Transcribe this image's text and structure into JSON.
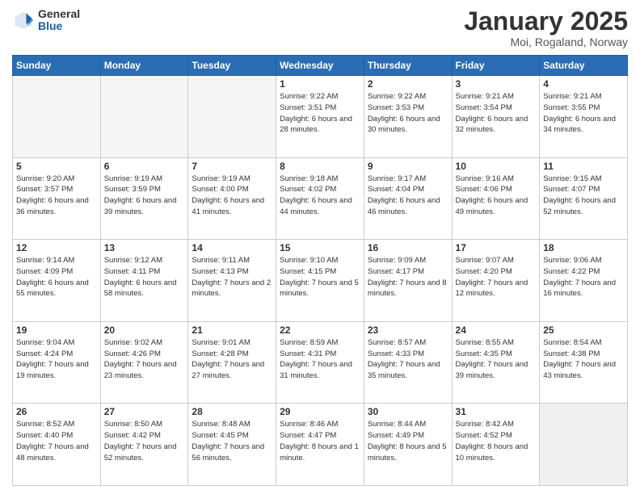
{
  "header": {
    "logo_general": "General",
    "logo_blue": "Blue",
    "month_title": "January 2025",
    "location": "Moi, Rogaland, Norway"
  },
  "weekdays": [
    "Sunday",
    "Monday",
    "Tuesday",
    "Wednesday",
    "Thursday",
    "Friday",
    "Saturday"
  ],
  "weeks": [
    [
      {
        "day": "",
        "empty": true
      },
      {
        "day": "",
        "empty": true
      },
      {
        "day": "",
        "empty": true
      },
      {
        "day": "1",
        "sunrise": "9:22 AM",
        "sunset": "3:51 PM",
        "daylight": "6 hours and 28 minutes."
      },
      {
        "day": "2",
        "sunrise": "9:22 AM",
        "sunset": "3:53 PM",
        "daylight": "6 hours and 30 minutes."
      },
      {
        "day": "3",
        "sunrise": "9:21 AM",
        "sunset": "3:54 PM",
        "daylight": "6 hours and 32 minutes."
      },
      {
        "day": "4",
        "sunrise": "9:21 AM",
        "sunset": "3:55 PM",
        "daylight": "6 hours and 34 minutes."
      }
    ],
    [
      {
        "day": "5",
        "sunrise": "9:20 AM",
        "sunset": "3:57 PM",
        "daylight": "6 hours and 36 minutes."
      },
      {
        "day": "6",
        "sunrise": "9:19 AM",
        "sunset": "3:59 PM",
        "daylight": "6 hours and 39 minutes."
      },
      {
        "day": "7",
        "sunrise": "9:19 AM",
        "sunset": "4:00 PM",
        "daylight": "6 hours and 41 minutes."
      },
      {
        "day": "8",
        "sunrise": "9:18 AM",
        "sunset": "4:02 PM",
        "daylight": "6 hours and 44 minutes."
      },
      {
        "day": "9",
        "sunrise": "9:17 AM",
        "sunset": "4:04 PM",
        "daylight": "6 hours and 46 minutes."
      },
      {
        "day": "10",
        "sunrise": "9:16 AM",
        "sunset": "4:06 PM",
        "daylight": "6 hours and 49 minutes."
      },
      {
        "day": "11",
        "sunrise": "9:15 AM",
        "sunset": "4:07 PM",
        "daylight": "6 hours and 52 minutes."
      }
    ],
    [
      {
        "day": "12",
        "sunrise": "9:14 AM",
        "sunset": "4:09 PM",
        "daylight": "6 hours and 55 minutes."
      },
      {
        "day": "13",
        "sunrise": "9:12 AM",
        "sunset": "4:11 PM",
        "daylight": "6 hours and 58 minutes."
      },
      {
        "day": "14",
        "sunrise": "9:11 AM",
        "sunset": "4:13 PM",
        "daylight": "7 hours and 2 minutes."
      },
      {
        "day": "15",
        "sunrise": "9:10 AM",
        "sunset": "4:15 PM",
        "daylight": "7 hours and 5 minutes."
      },
      {
        "day": "16",
        "sunrise": "9:09 AM",
        "sunset": "4:17 PM",
        "daylight": "7 hours and 8 minutes."
      },
      {
        "day": "17",
        "sunrise": "9:07 AM",
        "sunset": "4:20 PM",
        "daylight": "7 hours and 12 minutes."
      },
      {
        "day": "18",
        "sunrise": "9:06 AM",
        "sunset": "4:22 PM",
        "daylight": "7 hours and 16 minutes."
      }
    ],
    [
      {
        "day": "19",
        "sunrise": "9:04 AM",
        "sunset": "4:24 PM",
        "daylight": "7 hours and 19 minutes."
      },
      {
        "day": "20",
        "sunrise": "9:02 AM",
        "sunset": "4:26 PM",
        "daylight": "7 hours and 23 minutes."
      },
      {
        "day": "21",
        "sunrise": "9:01 AM",
        "sunset": "4:28 PM",
        "daylight": "7 hours and 27 minutes."
      },
      {
        "day": "22",
        "sunrise": "8:59 AM",
        "sunset": "4:31 PM",
        "daylight": "7 hours and 31 minutes."
      },
      {
        "day": "23",
        "sunrise": "8:57 AM",
        "sunset": "4:33 PM",
        "daylight": "7 hours and 35 minutes."
      },
      {
        "day": "24",
        "sunrise": "8:55 AM",
        "sunset": "4:35 PM",
        "daylight": "7 hours and 39 minutes."
      },
      {
        "day": "25",
        "sunrise": "8:54 AM",
        "sunset": "4:38 PM",
        "daylight": "7 hours and 43 minutes."
      }
    ],
    [
      {
        "day": "26",
        "sunrise": "8:52 AM",
        "sunset": "4:40 PM",
        "daylight": "7 hours and 48 minutes."
      },
      {
        "day": "27",
        "sunrise": "8:50 AM",
        "sunset": "4:42 PM",
        "daylight": "7 hours and 52 minutes."
      },
      {
        "day": "28",
        "sunrise": "8:48 AM",
        "sunset": "4:45 PM",
        "daylight": "7 hours and 56 minutes."
      },
      {
        "day": "29",
        "sunrise": "8:46 AM",
        "sunset": "4:47 PM",
        "daylight": "8 hours and 1 minute."
      },
      {
        "day": "30",
        "sunrise": "8:44 AM",
        "sunset": "4:49 PM",
        "daylight": "8 hours and 5 minutes."
      },
      {
        "day": "31",
        "sunrise": "8:42 AM",
        "sunset": "4:52 PM",
        "daylight": "8 hours and 10 minutes."
      },
      {
        "day": "",
        "empty": true,
        "last": true
      }
    ]
  ]
}
